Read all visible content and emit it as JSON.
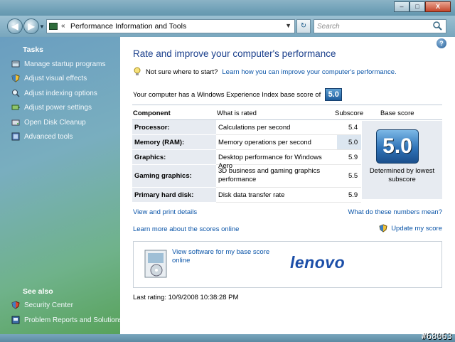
{
  "window": {
    "min": "–",
    "max": "□",
    "close": "X"
  },
  "address": {
    "path": "Performance Information and Tools",
    "search_placeholder": "Search"
  },
  "sidebar": {
    "tasks_heading": "Tasks",
    "items": [
      {
        "label": "Manage startup programs",
        "icon": "startup-icon"
      },
      {
        "label": "Adjust visual effects",
        "icon": "shield-icon"
      },
      {
        "label": "Adjust indexing options",
        "icon": "indexing-icon"
      },
      {
        "label": "Adjust power settings",
        "icon": "power-icon"
      },
      {
        "label": "Open Disk Cleanup",
        "icon": "disk-icon"
      },
      {
        "label": "Advanced tools",
        "icon": "tools-icon"
      }
    ],
    "see_also_heading": "See also",
    "see_also": [
      {
        "label": "Security Center",
        "icon": "security-center-icon"
      },
      {
        "label": "Problem Reports and Solutions",
        "icon": "problem-reports-icon"
      }
    ]
  },
  "main": {
    "title": "Rate and improve your computer's performance",
    "tip_text": "Not sure where to start?",
    "tip_link": "Learn how you can improve your computer's performance.",
    "base_text": "Your computer has a Windows Experience Index base score of",
    "base_score": "5.0",
    "headers": {
      "component": "Component",
      "rated": "What is rated",
      "subscore": "Subscore",
      "base": "Base score"
    },
    "rows": [
      {
        "component": "Processor:",
        "rated": "Calculations per second",
        "subscore": "5.4"
      },
      {
        "component": "Memory (RAM):",
        "rated": "Memory operations per second",
        "subscore": "5.0"
      },
      {
        "component": "Graphics:",
        "rated": "Desktop performance for Windows Aero",
        "subscore": "5.9"
      },
      {
        "component": "Gaming graphics:",
        "rated": "3D business and gaming graphics performance",
        "subscore": "5.5"
      },
      {
        "component": "Primary hard disk:",
        "rated": "Disk data transfer rate",
        "subscore": "5.9"
      }
    ],
    "big_score": "5.0",
    "big_caption": "Determined by lowest subscore",
    "view_print": "View and print details",
    "what_mean": "What do these numbers mean?",
    "learn_more": "Learn more about the scores online",
    "update": "Update my score",
    "promo_text": "View software for my base score online",
    "brand": "lenovo",
    "last_rating": "Last rating: 10/9/2008 10:38:28 PM"
  },
  "watermark": "#68063"
}
